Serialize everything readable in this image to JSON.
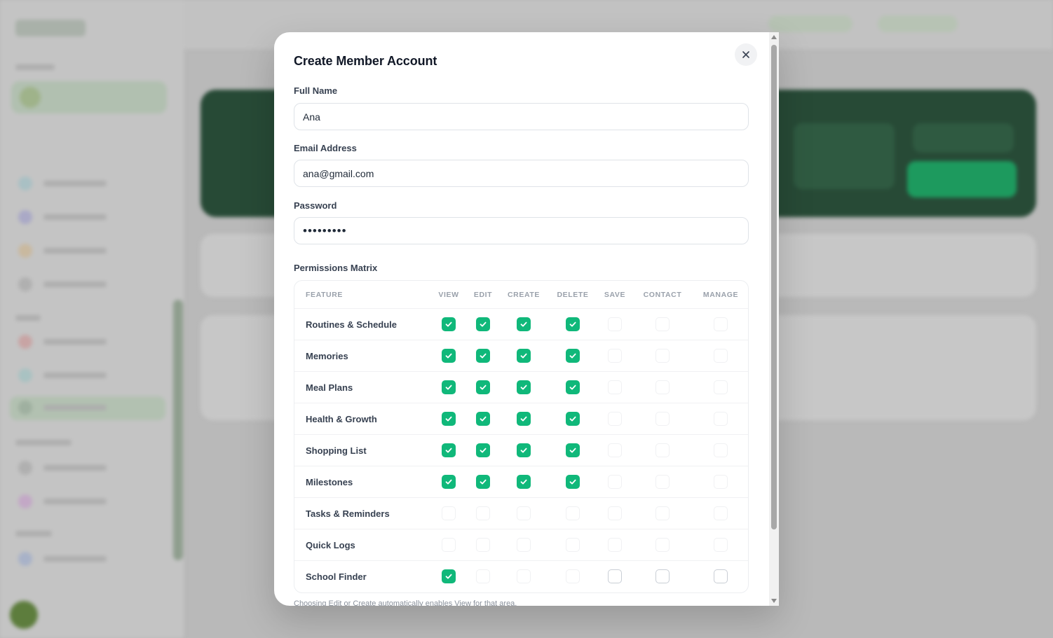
{
  "modal": {
    "title": "Create Member Account",
    "close_icon": "close-icon",
    "fields": {
      "full_name": {
        "label": "Full Name",
        "value": "Ana"
      },
      "email": {
        "label": "Email Address",
        "value": "ana@gmail.com"
      },
      "password": {
        "label": "Password",
        "value": "•••••••••"
      }
    },
    "permissions": {
      "label": "Permissions Matrix",
      "columns": [
        "FEATURE",
        "VIEW",
        "EDIT",
        "CREATE",
        "DELETE",
        "SAVE",
        "CONTACT",
        "MANAGE"
      ],
      "rows": [
        {
          "feature": "Routines & Schedule",
          "checks": [
            true,
            true,
            true,
            true,
            false,
            false,
            false
          ]
        },
        {
          "feature": "Memories",
          "checks": [
            true,
            true,
            true,
            true,
            false,
            false,
            false
          ]
        },
        {
          "feature": "Meal Plans",
          "checks": [
            true,
            true,
            true,
            true,
            false,
            false,
            false
          ]
        },
        {
          "feature": "Health & Growth",
          "checks": [
            true,
            true,
            true,
            true,
            false,
            false,
            false
          ]
        },
        {
          "feature": "Shopping List",
          "checks": [
            true,
            true,
            true,
            true,
            false,
            false,
            false
          ]
        },
        {
          "feature": "Milestones",
          "checks": [
            true,
            true,
            true,
            true,
            false,
            false,
            false
          ]
        },
        {
          "feature": "Tasks & Reminders",
          "checks": [
            false,
            false,
            false,
            false,
            false,
            false,
            false
          ]
        },
        {
          "feature": "Quick Logs",
          "checks": [
            false,
            false,
            false,
            false,
            false,
            false,
            false
          ]
        },
        {
          "feature": "School Finder",
          "checks": [
            true,
            false,
            false,
            false,
            false,
            false,
            false
          ]
        }
      ],
      "hint": "Choosing Edit or Create automatically enables View for that area."
    }
  },
  "colors": {
    "accent": "#10b87a",
    "overlay": "#b9b9b9",
    "hero": "#274a36"
  }
}
